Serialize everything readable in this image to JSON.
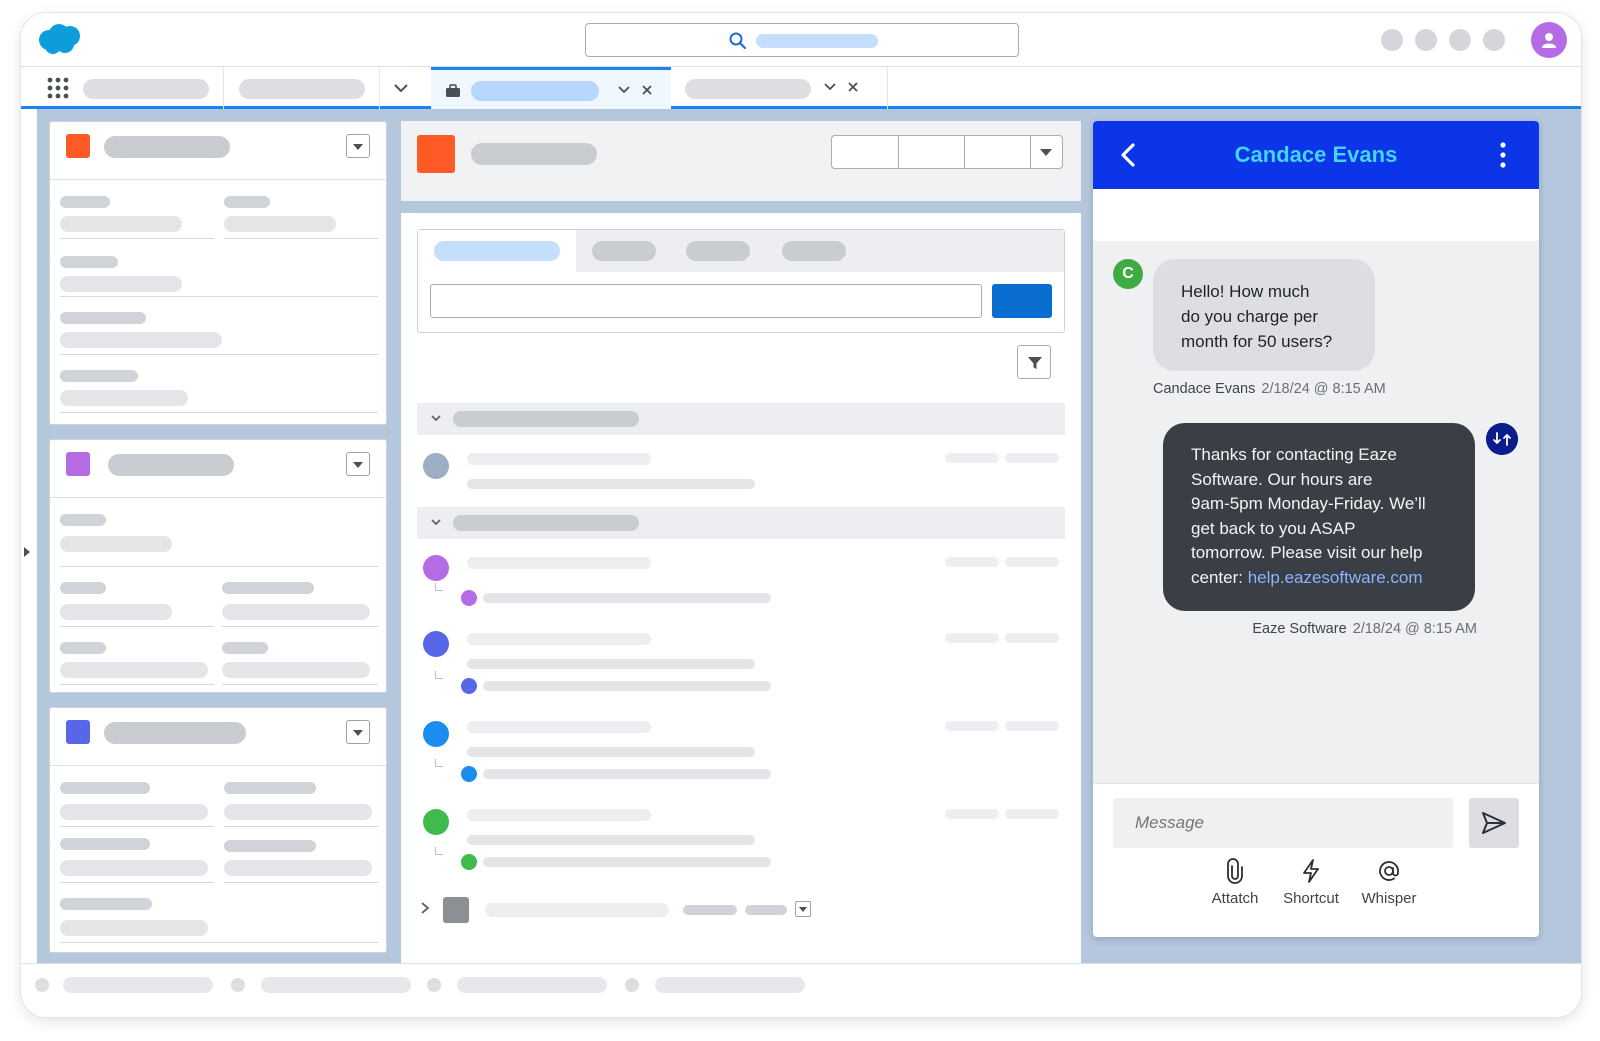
{
  "header": {
    "logo_icon": "cloud-logo",
    "search_icon": "search-icon",
    "avatar_icon": "user-icon"
  },
  "tabs": {
    "active_icon": "briefcase-icon"
  },
  "chat": {
    "title": "Candace Evans",
    "back_icon": "chevron-left-icon",
    "more_icon": "kebab-menu-icon",
    "incoming": {
      "avatar_initial": "C",
      "lines": [
        "Hello! How much",
        "do you charge per",
        "month for 50 users?"
      ],
      "sender": "Candace Evans",
      "timestamp": "2/18/24 @ 8:15 AM"
    },
    "outgoing": {
      "lines": [
        "Thanks for contacting Eaze",
        "Software. Our hours are",
        "9am-5pm Monday-Friday. We’ll",
        "get back to you ASAP",
        "tomorrow. Please visit our help"
      ],
      "last_line_prefix": "center: ",
      "link": "help.eazesoftware.com",
      "sender": "Eaze Software",
      "timestamp": "2/18/24 @ 8:15 AM"
    },
    "message_placeholder": "Message",
    "actions": {
      "attach": "Attatch",
      "shortcut": "Shortcut",
      "whisper": "Whisper"
    }
  },
  "colors": {
    "brand_blue": "#0b35e6",
    "title_cyan": "#43d4f8",
    "accent_tab": "#1b83f0",
    "feed_button": "#0a6ed1",
    "card1_square": "#fd5a25",
    "card2_square": "#b46be4",
    "card3_square": "#5867e8"
  }
}
